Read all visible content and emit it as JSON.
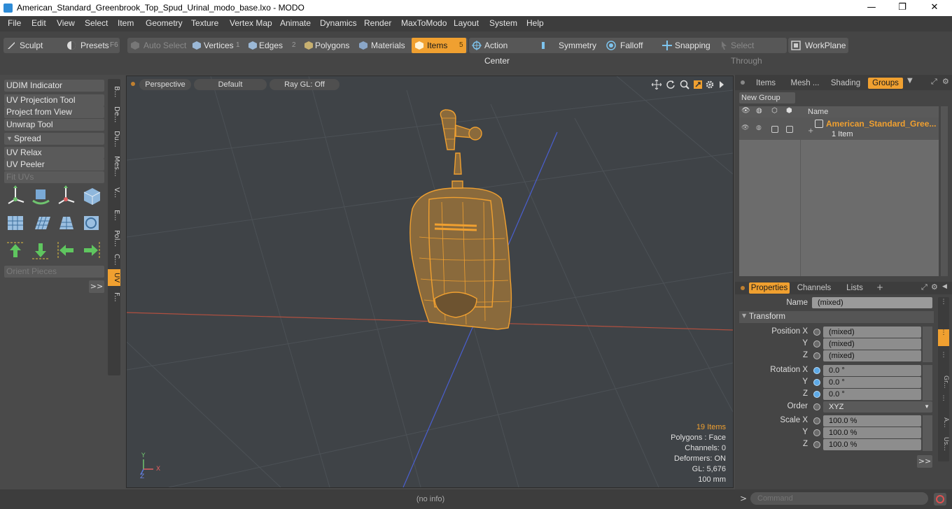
{
  "window": {
    "title": "American_Standard_Greenbrook_Top_Spud_Urinal_modo_base.lxo - MODO",
    "minimize": "—",
    "maximize": "❐",
    "close": "✕"
  },
  "menu": [
    "File",
    "Edit",
    "View",
    "Select",
    "Item",
    "Geometry",
    "Texture",
    "Vertex Map",
    "Animate",
    "Dynamics",
    "Render",
    "MaxToModo",
    "Layout",
    "System",
    "Help"
  ],
  "toolbar": {
    "sculpt": "Sculpt",
    "presets": "Presets",
    "presets_key": "F6",
    "auto_select": "Auto Select",
    "vertices": "Vertices",
    "vertices_key": "1",
    "edges": "Edges",
    "edges_key": "2",
    "polygons": "Polygons",
    "materials": "Materials",
    "items": "Items",
    "items_key": "5",
    "action_center": "Action Center",
    "symmetry": "Symmetry",
    "falloff": "Falloff",
    "snapping": "Snapping",
    "select_through": "Select Through",
    "workplane": "WorkPlane",
    "accent": "#f0a030"
  },
  "left_panel": {
    "buttons": [
      "UDIM Indicator",
      "UV Projection Tool",
      "Project from View",
      "Unwrap Tool"
    ],
    "spread_section": "Spread",
    "buttons2": [
      "UV Relax",
      "UV Peeler"
    ],
    "fit_uvs": "Fit UVs",
    "orient_pieces": "Orient Pieces",
    "more": ">>",
    "vtabs": [
      "B...",
      "De...",
      "Du...",
      "Mes...",
      "V...",
      "E...",
      "Pol...",
      "C...",
      "UV",
      "F..."
    ]
  },
  "viewport": {
    "perspective": "Perspective",
    "default": "Default",
    "raygl": "Ray GL: Off",
    "info": {
      "items": "19 Items",
      "polygons": "Polygons : Face",
      "channels": "Channels: 0",
      "deformers": "Deformers: ON",
      "gl": "GL: 5,676",
      "scale": "100 mm"
    },
    "axes": {
      "y": "Y",
      "z": "Z",
      "x": "X"
    }
  },
  "right_panel": {
    "tabs": [
      "Items",
      "Mesh ...",
      "Shading",
      "Groups"
    ],
    "new_group": "New Group",
    "name_header": "Name",
    "group_name": "American_Standard_Gree...",
    "group_count": "1 Item",
    "prop_tabs": [
      "Properties",
      "Channels",
      "Lists"
    ],
    "add": "+",
    "name_label": "Name",
    "name_value": "(mixed)",
    "transform": "Transform",
    "position_x_label": "Position X",
    "y_label": "Y",
    "z_label": "Z",
    "position_x": "(mixed)",
    "position_y": "(mixed)",
    "position_z": "(mixed)",
    "rotation_x_label": "Rotation X",
    "rotation_x": "0.0 °",
    "rotation_y": "0.0 °",
    "rotation_z": "0.0 °",
    "order_label": "Order",
    "order": "XYZ",
    "scale_x_label": "Scale X",
    "scale_x": "100.0 %",
    "scale_y": "100.0 %",
    "scale_z": "100.0 %",
    "more": ">>",
    "side_tabs": [
      "Gr...",
      "A...",
      "Us..."
    ]
  },
  "status": {
    "info": "(no info)",
    "command_placeholder": "Command",
    "prompt": ">"
  }
}
